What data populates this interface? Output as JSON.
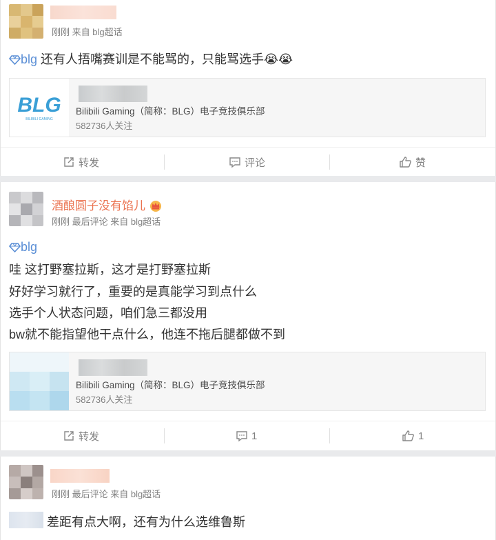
{
  "posts": [
    {
      "meta": "刚刚 来自 blg超话",
      "topic": "blg",
      "lines": [
        "还有人捂嘴赛训是不能骂的，只能骂选手😭😭"
      ],
      "embed": {
        "logo_text": "BLG",
        "logo_sub": "BILIBILI GAMING",
        "desc": "Bilibili Gaming（简称：BLG）电子竞技俱乐部",
        "followers": "582736人关注"
      },
      "actions": {
        "repost": "转发",
        "comment": "评论",
        "like": "赞"
      }
    },
    {
      "username": "酒酿圆子没有馅儿",
      "meta": "刚刚 最后评论 来自 blg超话",
      "topic": "blg",
      "lines": [
        "哇 这打野塞拉斯，这才是打野塞拉斯",
        "好好学习就行了，重要的是真能学习到点什么",
        "选手个人状态问题，咱们急三都没用",
        "bw就不能指望他干点什么，他连不拖后腿都做不到"
      ],
      "embed": {
        "desc": "Bilibili Gaming（简称：BLG）电子竞技俱乐部",
        "followers": "582736人关注"
      },
      "actions": {
        "repost": "转发",
        "comment": "1",
        "like": "1"
      }
    },
    {
      "meta": "刚刚 最后评论 来自 blg超话",
      "lines": [
        "差距有点大啊，还有为什么选维鲁斯"
      ]
    }
  ],
  "colors": {
    "accent": "#eb7350",
    "topic_icon": "#5b8fd6",
    "blg_blue": "#3a9fd6"
  }
}
